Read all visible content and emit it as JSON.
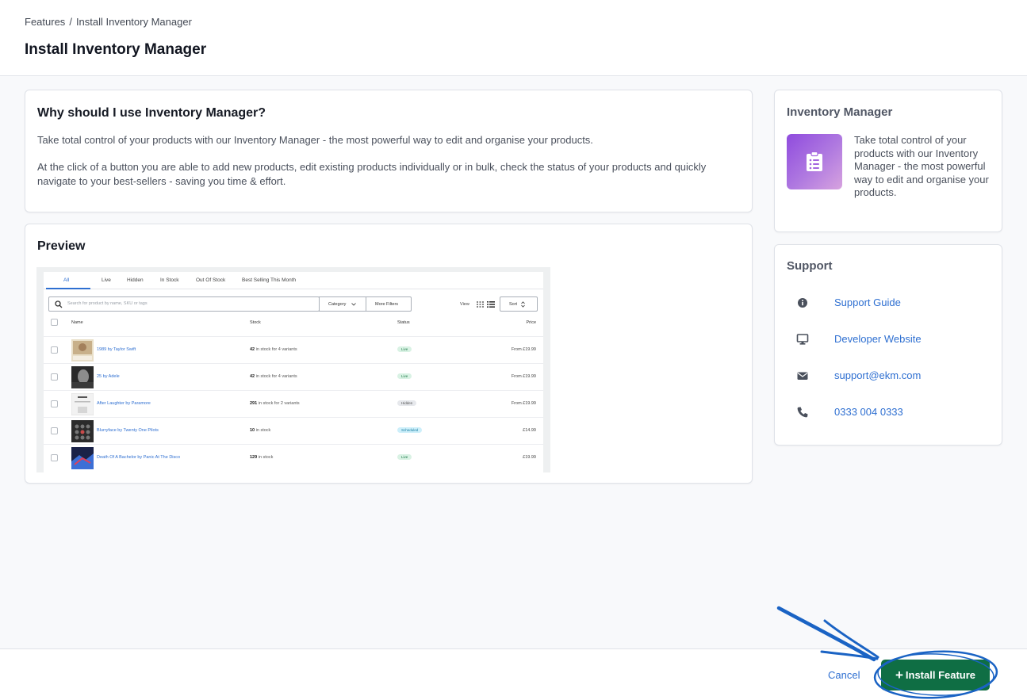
{
  "header": {
    "breadcrumb": [
      "Features",
      "Install Inventory Manager"
    ],
    "breadcrumb_separator": "/",
    "title": "Install Inventory Manager"
  },
  "why": {
    "heading": "Why should I use Inventory Manager?",
    "p1": "Take total control of your products with our Inventory Manager - the most powerful way to edit and organise your products.",
    "p2": "At the click of a button you are able to add new products, edit existing products individually or in bulk, check the status of your products and quickly navigate to your best-sellers - saving you time & effort."
  },
  "preview": {
    "heading": "Preview",
    "tabs": [
      "All",
      "Live",
      "Hidden",
      "In Stock",
      "Out Of Stock",
      "Best Selling This Month"
    ],
    "search_placeholder": "Search for product by name, SKU or tags",
    "category_label": "Category",
    "filters_label": "More Filters",
    "view_label": "View",
    "sort_label": "Sort",
    "columns": [
      "Name",
      "Stock",
      "Status",
      "Price"
    ],
    "rows": [
      {
        "name": "1989 by Taylor Swift",
        "stock_count": "42",
        "stock_text": "in stock for 4 variants",
        "status": "Live",
        "price": "From £19.99"
      },
      {
        "name": "25 by Adele",
        "stock_count": "42",
        "stock_text": "in stock for 4 variants",
        "status": "Live",
        "price": "From £19.99"
      },
      {
        "name": "After Laughter by Paramore",
        "stock_count": "291",
        "stock_text": "in stock for 2 variants",
        "status": "Hidden",
        "price": "From £19.99"
      },
      {
        "name": "Blurryface by Twenty One Pilots",
        "stock_count": "10",
        "stock_text": "in stock",
        "status": "Scheduled",
        "price": "£14.99"
      },
      {
        "name": "Death Of A Bachelor by Panic At The Disco",
        "stock_count": "129",
        "stock_text": "in stock",
        "status": "Live",
        "price": "£19.99"
      }
    ]
  },
  "info": {
    "heading": "Inventory Manager",
    "description": "Take total control of your products with our Inventory Manager - the most powerful way to edit and organise your products.",
    "icon": "clipboard-list-icon"
  },
  "support": {
    "heading": "Support",
    "items": [
      {
        "icon": "info-circle-icon",
        "label": "Support Guide"
      },
      {
        "icon": "monitor-icon",
        "label": "Developer Website"
      },
      {
        "icon": "envelope-icon",
        "label": "support@ekm.com"
      },
      {
        "icon": "phone-icon",
        "label": "0333 004 0333"
      }
    ]
  },
  "footer": {
    "cancel_label": "Cancel",
    "install_label": "Install Feature"
  },
  "colors": {
    "accent_link": "#2e6fd1",
    "install_button": "#0f6e44",
    "annotation": "#1a63c4",
    "badge_live": "#d9f2e4",
    "badge_hidden": "#e6e8ec",
    "badge_scheduled": "#cdeffa"
  }
}
